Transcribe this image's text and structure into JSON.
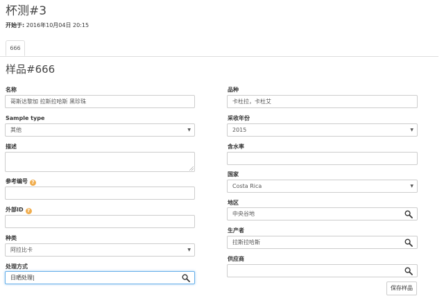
{
  "header": {
    "title": "杯测#3",
    "started_label": "开始于:",
    "started_value": " 2016年10月04日 20:15"
  },
  "tabs": [
    {
      "label": "666",
      "active": true
    }
  ],
  "sample": {
    "title": "样品#666"
  },
  "fields": {
    "name": {
      "label": "名称",
      "value": "哥斯达黎加 拉斯拉哈斯 黑珍珠"
    },
    "sample_type": {
      "label": "Sample type",
      "value": "其他"
    },
    "description": {
      "label": "描述",
      "value": ""
    },
    "reference_number": {
      "label": "参考编号",
      "value": ""
    },
    "external_id": {
      "label": "外部ID",
      "value": ""
    },
    "species": {
      "label": "种类",
      "value": "阿拉比卡"
    },
    "processing": {
      "label": "处理方式",
      "value": "日晒处理|"
    },
    "variety": {
      "label": "品种",
      "value": "卡杜拉，卡杜艾"
    },
    "harvest_year": {
      "label": "采收年份",
      "value": "2015"
    },
    "moisture": {
      "label": "含水率",
      "value": ""
    },
    "country": {
      "label": "国家",
      "value": "Costa Rica"
    },
    "region": {
      "label": "地区",
      "value": "中央谷地"
    },
    "producer": {
      "label": "生产者",
      "value": "拉斯拉哈斯"
    },
    "supplier": {
      "label": "供应商",
      "value": ""
    }
  },
  "help_icon_glyph": "?",
  "select_caret_glyph": "▼",
  "actions": {
    "save_label": "保存样品"
  },
  "colors": {
    "focus_border": "#66afe9",
    "help_icon": "#f0ad4e",
    "border": "#cccccc"
  }
}
